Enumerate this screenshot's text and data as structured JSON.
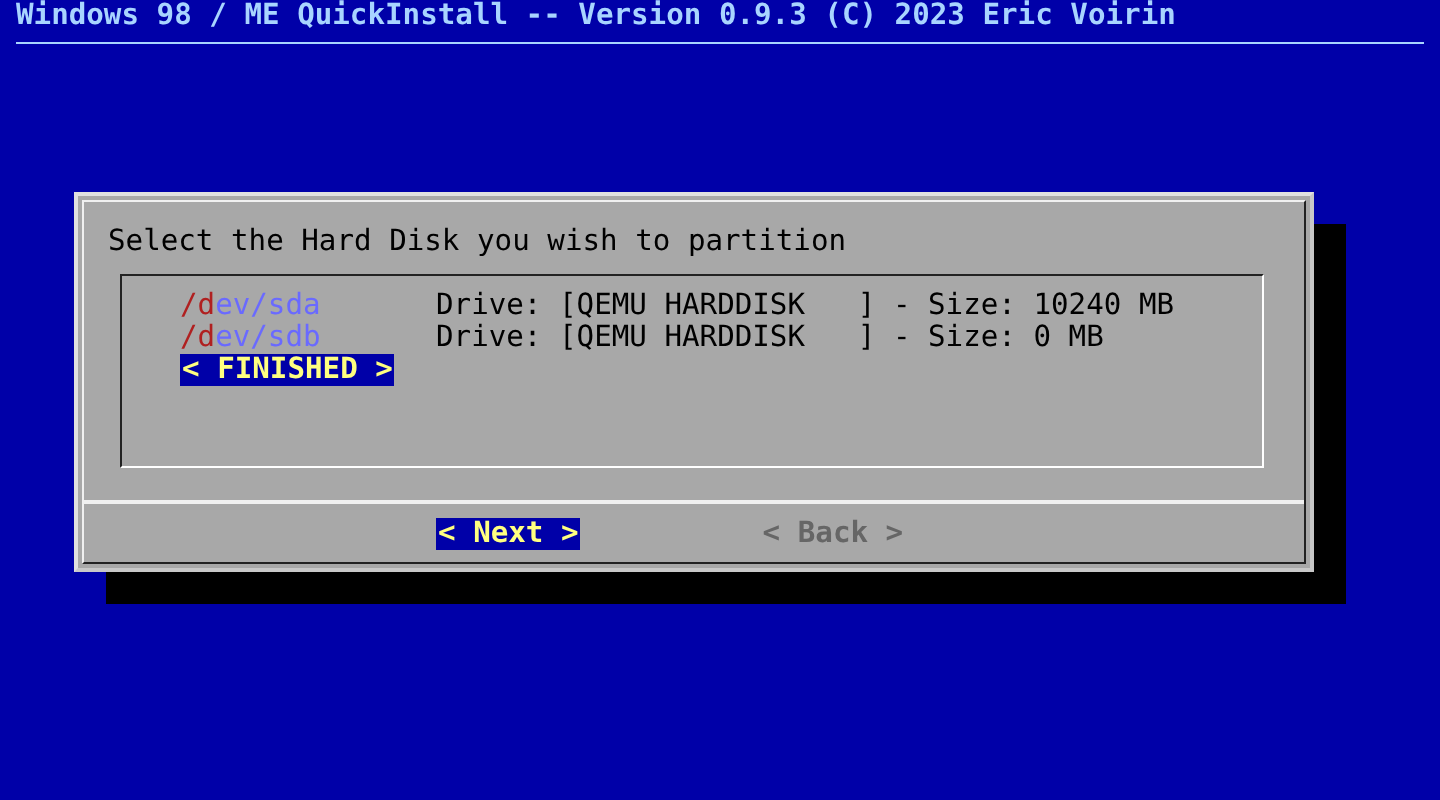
{
  "header": {
    "title": "Windows 98 / ME QuickInstall -- Version 0.9.3 (C) 2023 Eric Voirin"
  },
  "dialog": {
    "prompt": "Select the Hard Disk you wish to partition",
    "items": [
      {
        "kind": "disk",
        "tag": "/dev/sda",
        "description": "Drive: [QEMU HARDDISK   ] - Size: 10240 MB",
        "selected": false
      },
      {
        "kind": "disk",
        "tag": "/dev/sdb",
        "description": "Drive: [QEMU HARDDISK   ] - Size: 0 MB",
        "selected": false
      },
      {
        "kind": "action",
        "label": "< FINISHED >",
        "selected": true
      }
    ],
    "buttons": [
      {
        "label": "< Next >",
        "selected": true
      },
      {
        "label": "< Back >",
        "selected": false
      }
    ]
  }
}
